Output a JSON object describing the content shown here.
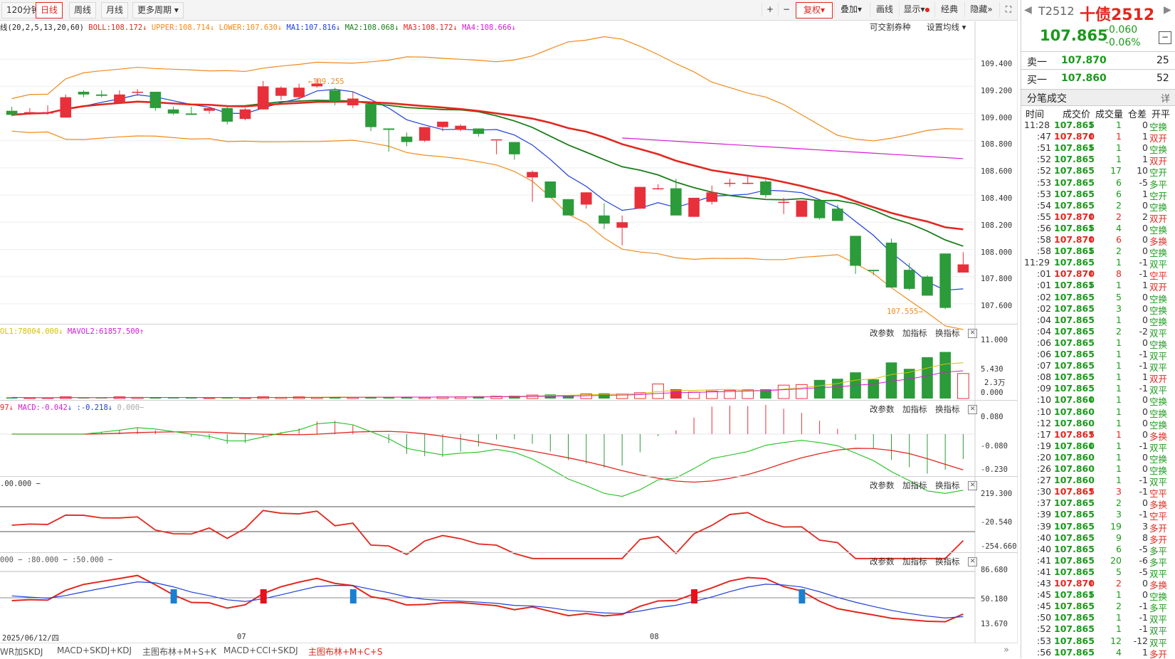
{
  "toolbar": {
    "periods": [
      "120分钟",
      "日线",
      "周线",
      "月线",
      "更多周期"
    ],
    "active_period": "日线",
    "right_buttons": [
      "+",
      "−",
      "复权",
      "叠加",
      "画线",
      "显示",
      "经典",
      "隐藏",
      "⛶"
    ],
    "active_right": "复权"
  },
  "main": {
    "boll_legend": {
      "params": "线(20,2,5,13,20,60)",
      "boll": "BOLL:108.172",
      "upper": "UPPER:108.714",
      "lower": "LOWER:107.630",
      "ma1": "MA1:107.816",
      "ma2": "MA2:108.068",
      "ma3": "MA3:108.172",
      "ma4": "MA4:108.666"
    },
    "links": [
      "可交割券种",
      "设置均线"
    ],
    "y_ticks": [
      "109.400",
      "109.200",
      "109.000",
      "108.800",
      "108.600",
      "108.400",
      "108.200",
      "108.000",
      "107.800",
      "107.600"
    ],
    "high_label": "109.255",
    "low_label": "107.555"
  },
  "volume": {
    "legend_vol1": "OL1:78004.000",
    "legend_vol2": "MAVOL2:61857.500",
    "y_ticks": [
      "11.000",
      "5.430",
      "2.3万",
      "0.000"
    ]
  },
  "macd": {
    "legend_a": "97",
    "legend_macd": "MACD:-0.042",
    "legend_c": ":-0.218",
    "legend_d": "0.000",
    "y_ticks": [
      "0.080",
      "-0.080",
      "-0.230"
    ]
  },
  "cci": {
    "legend": ".00.000",
    "y_ticks": [
      "219.300",
      "-20.540",
      "-254.660"
    ]
  },
  "kdj": {
    "legend_a": "000",
    "legend_b": ":80.000",
    "legend_c": ":50.000",
    "y_ticks": [
      "86.680",
      "50.180",
      "13.670"
    ]
  },
  "panel_buttons": [
    "改参数",
    "加指标",
    "换指标"
  ],
  "x_axis": [
    "2025/06/12/四",
    "07",
    "08"
  ],
  "bottom_tabs": [
    "WR加SKDJ",
    "MACD+SKDJ+KDJ",
    "主图布林+M+S+K",
    "MACD+CCI+SKDJ",
    "主图布林+M+C+S"
  ],
  "active_bottom_tab": "主图布林+M+C+S",
  "quote": {
    "code": "T2512",
    "name": "十债2512",
    "price": "107.865",
    "change": "-0.060",
    "change_pct": "-0.06%",
    "sell1_label": "卖一",
    "sell1_price": "107.870",
    "sell1_vol": "25",
    "buy1_label": "买一",
    "buy1_price": "107.860",
    "buy1_vol": "52",
    "trades_title": "分笔成交",
    "trades_detail": "详",
    "headers": [
      "时间",
      "成交价",
      "成交量",
      "仓差",
      "开平"
    ]
  },
  "trades": [
    {
      "t": "11:28",
      "p": "107.865",
      "a": "down",
      "v": "1",
      "d": "0",
      "k": "空换"
    },
    {
      "t": ":47",
      "p": "107.870",
      "a": "up",
      "v": "1",
      "d": "1",
      "k": "双开"
    },
    {
      "t": ":51",
      "p": "107.865",
      "a": "down",
      "v": "1",
      "d": "0",
      "k": "空换"
    },
    {
      "t": ":52",
      "p": "107.865",
      "a": "",
      "v": "1",
      "d": "1",
      "k": "双开"
    },
    {
      "t": ":52",
      "p": "107.865",
      "a": "",
      "v": "17",
      "d": "10",
      "k": "空开"
    },
    {
      "t": ":53",
      "p": "107.865",
      "a": "",
      "v": "6",
      "d": "-5",
      "k": "多平"
    },
    {
      "t": ":53",
      "p": "107.865",
      "a": "",
      "v": "6",
      "d": "1",
      "k": "空开"
    },
    {
      "t": ":54",
      "p": "107.865",
      "a": "",
      "v": "2",
      "d": "0",
      "k": "空换"
    },
    {
      "t": ":55",
      "p": "107.870",
      "a": "up",
      "v": "2",
      "d": "2",
      "k": "双开"
    },
    {
      "t": ":56",
      "p": "107.865",
      "a": "down",
      "v": "4",
      "d": "0",
      "k": "空换"
    },
    {
      "t": ":58",
      "p": "107.870",
      "a": "up",
      "v": "6",
      "d": "0",
      "k": "多换"
    },
    {
      "t": ":58",
      "p": "107.865",
      "a": "down",
      "v": "2",
      "d": "0",
      "k": "空换"
    },
    {
      "t": "11:29",
      "p": "107.865",
      "a": "",
      "v": "1",
      "d": "-1",
      "k": "双平"
    },
    {
      "t": ":01",
      "p": "107.870",
      "a": "up",
      "v": "8",
      "d": "-1",
      "k": "空平"
    },
    {
      "t": ":01",
      "p": "107.865",
      "a": "down",
      "v": "1",
      "d": "1",
      "k": "双开"
    },
    {
      "t": ":02",
      "p": "107.865",
      "a": "",
      "v": "5",
      "d": "0",
      "k": "空换"
    },
    {
      "t": ":02",
      "p": "107.865",
      "a": "",
      "v": "3",
      "d": "0",
      "k": "空换"
    },
    {
      "t": ":04",
      "p": "107.865",
      "a": "",
      "v": "1",
      "d": "0",
      "k": "空换"
    },
    {
      "t": ":04",
      "p": "107.865",
      "a": "",
      "v": "2",
      "d": "-2",
      "k": "双平"
    },
    {
      "t": ":06",
      "p": "107.865",
      "a": "",
      "v": "1",
      "d": "0",
      "k": "空换"
    },
    {
      "t": ":06",
      "p": "107.865",
      "a": "",
      "v": "1",
      "d": "-1",
      "k": "双平"
    },
    {
      "t": ":07",
      "p": "107.865",
      "a": "",
      "v": "1",
      "d": "-1",
      "k": "双平"
    },
    {
      "t": ":08",
      "p": "107.865",
      "a": "",
      "v": "1",
      "d": "1",
      "k": "双开"
    },
    {
      "t": ":09",
      "p": "107.865",
      "a": "",
      "v": "1",
      "d": "-1",
      "k": "双平"
    },
    {
      "t": ":10",
      "p": "107.860",
      "a": "down",
      "v": "1",
      "d": "0",
      "k": "空换"
    },
    {
      "t": ":10",
      "p": "107.860",
      "a": "",
      "v": "1",
      "d": "0",
      "k": "空换"
    },
    {
      "t": ":12",
      "p": "107.860",
      "a": "",
      "v": "1",
      "d": "0",
      "k": "空换"
    },
    {
      "t": ":17",
      "p": "107.865",
      "a": "up",
      "v": "1",
      "d": "0",
      "k": "多换"
    },
    {
      "t": ":19",
      "p": "107.860",
      "a": "down",
      "v": "1",
      "d": "-1",
      "k": "双平"
    },
    {
      "t": ":20",
      "p": "107.860",
      "a": "",
      "v": "1",
      "d": "0",
      "k": "空换"
    },
    {
      "t": ":26",
      "p": "107.860",
      "a": "",
      "v": "1",
      "d": "0",
      "k": "空换"
    },
    {
      "t": ":27",
      "p": "107.860",
      "a": "",
      "v": "1",
      "d": "-1",
      "k": "双平"
    },
    {
      "t": ":30",
      "p": "107.865",
      "a": "up",
      "v": "3",
      "d": "-1",
      "k": "空平"
    },
    {
      "t": ":37",
      "p": "107.865",
      "a": "",
      "v": "2",
      "d": "0",
      "k": "多换"
    },
    {
      "t": ":39",
      "p": "107.865",
      "a": "",
      "v": "3",
      "d": "-1",
      "k": "空平"
    },
    {
      "t": ":39",
      "p": "107.865",
      "a": "",
      "v": "19",
      "d": "3",
      "k": "多开"
    },
    {
      "t": ":40",
      "p": "107.865",
      "a": "",
      "v": "9",
      "d": "8",
      "k": "多开"
    },
    {
      "t": ":40",
      "p": "107.865",
      "a": "",
      "v": "6",
      "d": "-5",
      "k": "多平"
    },
    {
      "t": ":41",
      "p": "107.865",
      "a": "",
      "v": "20",
      "d": "-6",
      "k": "多平"
    },
    {
      "t": ":41",
      "p": "107.865",
      "a": "",
      "v": "5",
      "d": "-5",
      "k": "双平"
    },
    {
      "t": ":43",
      "p": "107.870",
      "a": "up",
      "v": "2",
      "d": "0",
      "k": "多换"
    },
    {
      "t": ":45",
      "p": "107.865",
      "a": "down",
      "v": "1",
      "d": "0",
      "k": "空换"
    },
    {
      "t": ":45",
      "p": "107.865",
      "a": "",
      "v": "2",
      "d": "-1",
      "k": "多平"
    },
    {
      "t": ":50",
      "p": "107.865",
      "a": "",
      "v": "1",
      "d": "-1",
      "k": "双平"
    },
    {
      "t": ":52",
      "p": "107.865",
      "a": "",
      "v": "1",
      "d": "-1",
      "k": "双平"
    },
    {
      "t": ":53",
      "p": "107.865",
      "a": "",
      "v": "12",
      "d": "-12",
      "k": "双平"
    },
    {
      "t": ":56",
      "p": "107.865",
      "a": "",
      "v": "4",
      "d": "1",
      "k": "多开"
    }
  ],
  "chart_data": {
    "type": "candlestick",
    "series": [
      {
        "name": "K",
        "ohlc": [
          [
            109.02,
            109.05,
            108.98,
            108.99
          ],
          [
            109.01,
            109.04,
            108.99,
            109.01
          ],
          [
            109.0,
            109.06,
            108.99,
            109.01
          ],
          [
            108.97,
            109.14,
            108.97,
            109.12
          ],
          [
            109.16,
            109.17,
            109.12,
            109.14
          ],
          [
            109.14,
            109.17,
            109.12,
            109.13
          ],
          [
            109.08,
            109.17,
            109.07,
            109.14
          ],
          [
            109.16,
            109.18,
            109.13,
            109.16
          ],
          [
            109.16,
            109.16,
            109.02,
            109.04
          ],
          [
            109.03,
            109.05,
            108.99,
            109.0
          ],
          [
            109.0,
            109.05,
            108.99,
            108.99
          ],
          [
            109.02,
            109.05,
            109.0,
            109.04
          ],
          [
            109.04,
            109.05,
            108.92,
            108.94
          ],
          [
            108.96,
            109.04,
            108.95,
            109.03
          ],
          [
            109.03,
            109.24,
            109.03,
            109.2
          ],
          [
            109.13,
            109.2,
            109.1,
            109.19
          ],
          [
            109.12,
            109.22,
            109.1,
            109.19
          ],
          [
            109.2,
            109.26,
            109.19,
            109.22
          ],
          [
            109.17,
            109.19,
            109.06,
            109.09
          ],
          [
            109.06,
            109.16,
            109.04,
            109.11
          ],
          [
            109.07,
            109.08,
            108.87,
            108.9
          ],
          [
            108.89,
            108.89,
            108.72,
            108.88
          ],
          [
            108.83,
            108.86,
            108.76,
            108.79
          ],
          [
            108.8,
            108.9,
            108.79,
            108.9
          ],
          [
            108.9,
            108.94,
            108.87,
            108.94
          ],
          [
            108.88,
            108.92,
            108.87,
            108.91
          ],
          [
            108.89,
            108.89,
            108.83,
            108.85
          ],
          [
            108.81,
            108.8,
            108.7,
            108.81
          ],
          [
            108.79,
            108.79,
            108.66,
            108.7
          ],
          [
            108.53,
            108.58,
            108.35,
            108.57
          ],
          [
            108.5,
            108.5,
            108.38,
            108.38
          ],
          [
            108.37,
            108.37,
            108.26,
            108.25
          ],
          [
            108.33,
            108.42,
            108.3,
            108.42
          ],
          [
            108.25,
            108.34,
            108.15,
            108.19
          ],
          [
            108.16,
            108.25,
            108.03,
            108.2
          ],
          [
            108.3,
            108.46,
            108.3,
            108.46
          ],
          [
            108.45,
            108.48,
            108.44,
            108.45
          ],
          [
            108.45,
            108.52,
            108.25,
            108.25
          ],
          [
            108.24,
            108.38,
            108.24,
            108.38
          ],
          [
            108.35,
            108.47,
            108.33,
            108.42
          ],
          [
            108.49,
            108.52,
            108.46,
            108.49
          ],
          [
            108.49,
            108.55,
            108.48,
            108.49
          ],
          [
            108.5,
            108.52,
            108.38,
            108.4
          ],
          [
            108.35,
            108.38,
            108.26,
            108.35
          ],
          [
            108.24,
            108.36,
            108.24,
            108.36
          ],
          [
            108.36,
            108.36,
            108.22,
            108.23
          ],
          [
            108.3,
            108.33,
            108.21,
            108.21
          ],
          [
            108.1,
            108.1,
            107.82,
            107.88
          ],
          [
            107.85,
            107.85,
            107.81,
            107.84
          ],
          [
            108.05,
            108.08,
            107.74,
            107.72
          ],
          [
            107.85,
            107.9,
            107.7,
            107.71
          ],
          [
            107.8,
            107.81,
            107.67,
            107.66
          ],
          [
            107.97,
            107.97,
            107.56,
            107.57
          ],
          [
            107.83,
            107.98,
            107.83,
            107.89
          ]
        ]
      }
    ],
    "volume": [
      0.2,
      0.1,
      0.1,
      0.3,
      0.1,
      0.1,
      0.3,
      0.2,
      0.2,
      0.1,
      0.2,
      0.1,
      0.2,
      0.1,
      0.3,
      0.2,
      0.3,
      0.2,
      0.3,
      0.2,
      0.3,
      0.2,
      0.3,
      0.2,
      0.3,
      0.3,
      0.4,
      0.4,
      0.5,
      0.6,
      0.7,
      0.6,
      0.8,
      0.9,
      0.8,
      1.0,
      2.5,
      1.6,
      1.1,
      1.3,
      1.4,
      1.5,
      1.6,
      2.3,
      2.4,
      3.2,
      3.4,
      4.5,
      3.3,
      6.2,
      5.1,
      7.1,
      8.0,
      4.3
    ],
    "ylim": [
      107.5,
      109.5
    ],
    "x_labels": [
      "2025/06/12/四",
      "07",
      "08"
    ]
  }
}
